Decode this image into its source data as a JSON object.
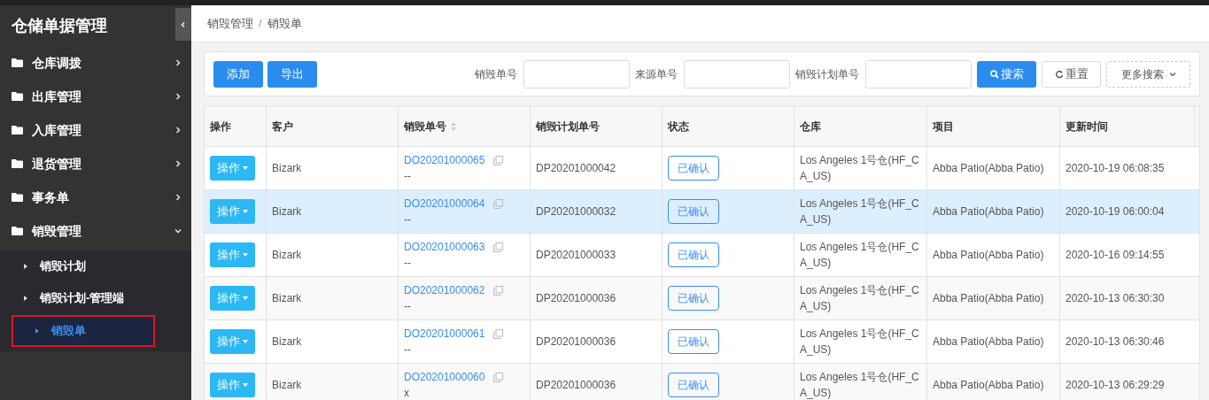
{
  "sidebar": {
    "title": "仓储单据管理",
    "items": [
      {
        "label": "仓库调拨",
        "expanded": false
      },
      {
        "label": "出库管理",
        "expanded": false
      },
      {
        "label": "入库管理",
        "expanded": false
      },
      {
        "label": "退货管理",
        "expanded": false
      },
      {
        "label": "事务单",
        "expanded": false
      },
      {
        "label": "销毁管理",
        "expanded": true,
        "children": [
          {
            "label": "销毁计划",
            "selected": false
          },
          {
            "label": "销毁计划-管理端",
            "selected": false
          },
          {
            "label": "销毁单",
            "selected": true
          }
        ]
      }
    ]
  },
  "breadcrumb": [
    "销毁管理",
    "/",
    "销毁单"
  ],
  "toolbar": {
    "buttons": [
      "添加",
      "导出"
    ],
    "filters": [
      {
        "label": "销毁单号"
      },
      {
        "label": "来源单号"
      },
      {
        "label": "销毁计划单号"
      }
    ],
    "search": "搜索",
    "reset": "重置",
    "more": "更多搜索"
  },
  "table": {
    "columns": [
      "操作",
      "客户",
      "销毁单号",
      "销毁计划单号",
      "状态",
      "仓库",
      "项目",
      "更新时间"
    ],
    "rows": [
      {
        "action": "操作",
        "customer": "Bizark",
        "order": "DO20201000065",
        "note": "--",
        "plan": "DP20201000042",
        "status": "已确认",
        "warehouse": "Los Angeles 1号仓(HF_CA_US)",
        "project": "Abba Patio(Abba Patio)",
        "updated": "2020-10-19 06:08:35",
        "selected": false
      },
      {
        "action": "操作",
        "customer": "Bizark",
        "order": "DO20201000064",
        "note": "--",
        "plan": "DP20201000032",
        "status": "已确认",
        "warehouse": "Los Angeles 1号仓(HF_CA_US)",
        "project": "Abba Patio(Abba Patio)",
        "updated": "2020-10-19 06:00:04",
        "selected": true
      },
      {
        "action": "操作",
        "customer": "Bizark",
        "order": "DO20201000063",
        "note": "--",
        "plan": "DP20201000033",
        "status": "已确认",
        "warehouse": "Los Angeles 1号仓(HF_CA_US)",
        "project": "Abba Patio(Abba Patio)",
        "updated": "2020-10-16 09:14:55",
        "selected": false
      },
      {
        "action": "操作",
        "customer": "Bizark",
        "order": "DO20201000062",
        "note": "--",
        "plan": "DP20201000036",
        "status": "已确认",
        "warehouse": "Los Angeles 1号仓(HF_CA_US)",
        "project": "Abba Patio(Abba Patio)",
        "updated": "2020-10-13 06:30:30",
        "selected": false
      },
      {
        "action": "操作",
        "customer": "Bizark",
        "order": "DO20201000061",
        "note": "--",
        "plan": "DP20201000036",
        "status": "已确认",
        "warehouse": "Los Angeles 1号仓(HF_CA_US)",
        "project": "Abba Patio(Abba Patio)",
        "updated": "2020-10-13 06:30:46",
        "selected": false
      },
      {
        "action": "操作",
        "customer": "Bizark",
        "order": "DO20201000060",
        "note": "x",
        "plan": "DP20201000036",
        "status": "已确认",
        "warehouse": "Los Angeles 1号仓(HF_CA_US)",
        "project": "Abba Patio(Abba Patio)",
        "updated": "2020-10-13 06:29:29",
        "selected": false
      }
    ]
  }
}
